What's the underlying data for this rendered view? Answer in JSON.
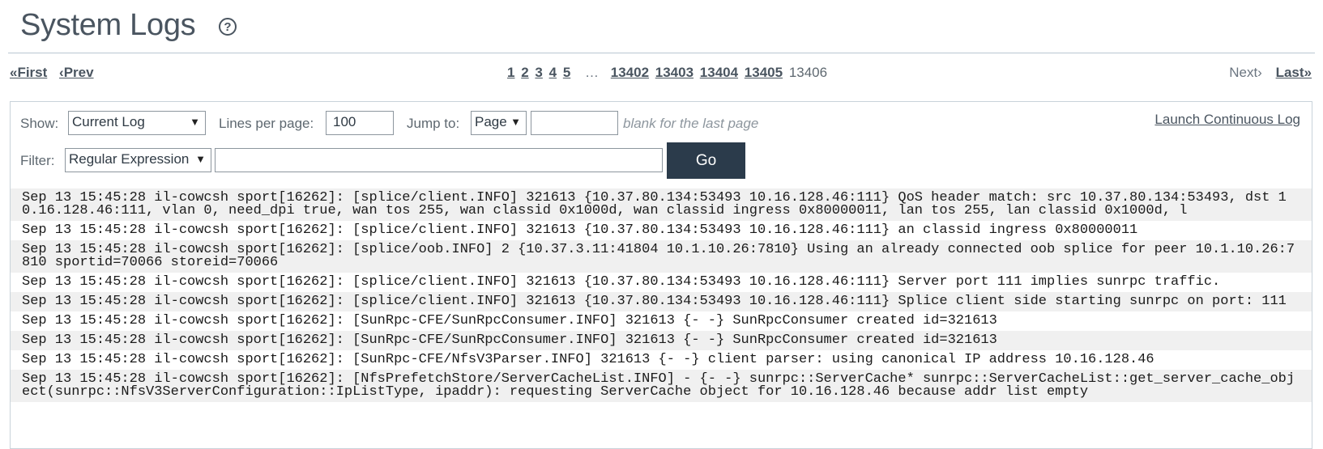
{
  "header": {
    "title": "System Logs"
  },
  "pager": {
    "first": "«First",
    "prev": "‹Prev",
    "pages_start": [
      "1",
      "2",
      "3",
      "4",
      "5"
    ],
    "ellipsis": "…",
    "pages_end": [
      "13402",
      "13403",
      "13404",
      "13405"
    ],
    "current": "13406",
    "next": "Next›",
    "last": "Last»"
  },
  "controls": {
    "show_label": "Show:",
    "show_value": "Current Log",
    "lines_label": "Lines per page:",
    "lines_value": "100",
    "jump_label": "Jump to:",
    "jump_value": "Page",
    "jump_input_value": "",
    "jump_hint": "blank for the last page",
    "launch_link": "Launch Continuous Log",
    "filter_label": "Filter:",
    "filter_type": "Regular Expression",
    "filter_value": "",
    "go_label": "Go"
  },
  "logs": [
    "Sep 13 15:45:28 il-cowcsh sport[16262]: [splice/client.INFO] 321613 {10.37.80.134:53493 10.16.128.46:111} QoS header match: src 10.37.80.134:53493, dst 10.16.128.46:111, vlan 0, need_dpi true, wan tos 255, wan classid 0x1000d, wan classid ingress 0x80000011, lan tos 255, lan classid 0x1000d, l",
    "Sep 13 15:45:28 il-cowcsh sport[16262]: [splice/client.INFO] 321613 {10.37.80.134:53493 10.16.128.46:111} an classid ingress 0x80000011",
    "Sep 13 15:45:28 il-cowcsh sport[16262]: [splice/oob.INFO] 2 {10.37.3.11:41804 10.1.10.26:7810} Using an already connected oob splice for peer 10.1.10.26:7810 sportid=70066 storeid=70066",
    "Sep 13 15:45:28 il-cowcsh sport[16262]: [splice/client.INFO] 321613 {10.37.80.134:53493 10.16.128.46:111} Server port 111 implies sunrpc traffic.",
    "Sep 13 15:45:28 il-cowcsh sport[16262]: [splice/client.INFO] 321613 {10.37.80.134:53493 10.16.128.46:111} Splice client side starting sunrpc on port: 111",
    "Sep 13 15:45:28 il-cowcsh sport[16262]: [SunRpc-CFE/SunRpcConsumer.INFO] 321613 {- -} SunRpcConsumer created id=321613",
    "Sep 13 15:45:28 il-cowcsh sport[16262]: [SunRpc-CFE/SunRpcConsumer.INFO] 321613 {- -} SunRpcConsumer created id=321613",
    "Sep 13 15:45:28 il-cowcsh sport[16262]: [SunRpc-CFE/NfsV3Parser.INFO] 321613 {- -} client parser: using canonical IP address 10.16.128.46",
    "Sep 13 15:45:28 il-cowcsh sport[16262]: [NfsPrefetchStore/ServerCacheList.INFO] - {- -} sunrpc::ServerCache* sunrpc::ServerCacheList::get_server_cache_object(sunrpc::NfsV3ServerConfiguration::IpListType, ipaddr): requesting ServerCache object for 10.16.128.46 because addr list empty"
  ]
}
